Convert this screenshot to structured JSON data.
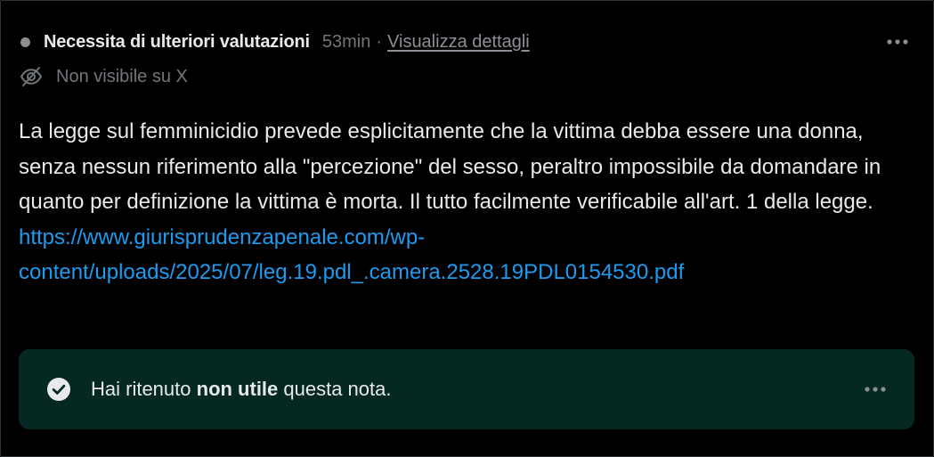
{
  "header": {
    "status_label": "Necessita di ulteriori valutazioni",
    "time": "53min",
    "separator": "·",
    "details_link": "Visualizza dettagli"
  },
  "visibility": {
    "text": "Non visibile su X"
  },
  "note": {
    "text": "La legge sul femminicidio prevede esplicitamente che la vittima debba essere una donna, senza nessun riferimento alla \"percezione\" del sesso, peraltro impossibile da domandare in quanto per definizione la vittima è morta. Il tutto facilmente verificabile all'art. 1 della legge.",
    "link": "https://www.giurisprudenzapenale.com/wp-content/uploads/2025/07/leg.19.pdl_.camera.2528.19PDL0154530.pdf"
  },
  "rating": {
    "prefix": "Hai ritenuto ",
    "emphasis": "non utile",
    "suffix": " questa nota."
  },
  "colors": {
    "background": "#000000",
    "text": "#e7e9ea",
    "muted": "#71767b",
    "link": "#1d9bf0",
    "rating_bg": "#052922"
  },
  "icons": {
    "status": "status-dot-icon",
    "more": "more-horizontal-icon",
    "visibility": "eye-off-icon",
    "rated": "check-circle-icon"
  }
}
